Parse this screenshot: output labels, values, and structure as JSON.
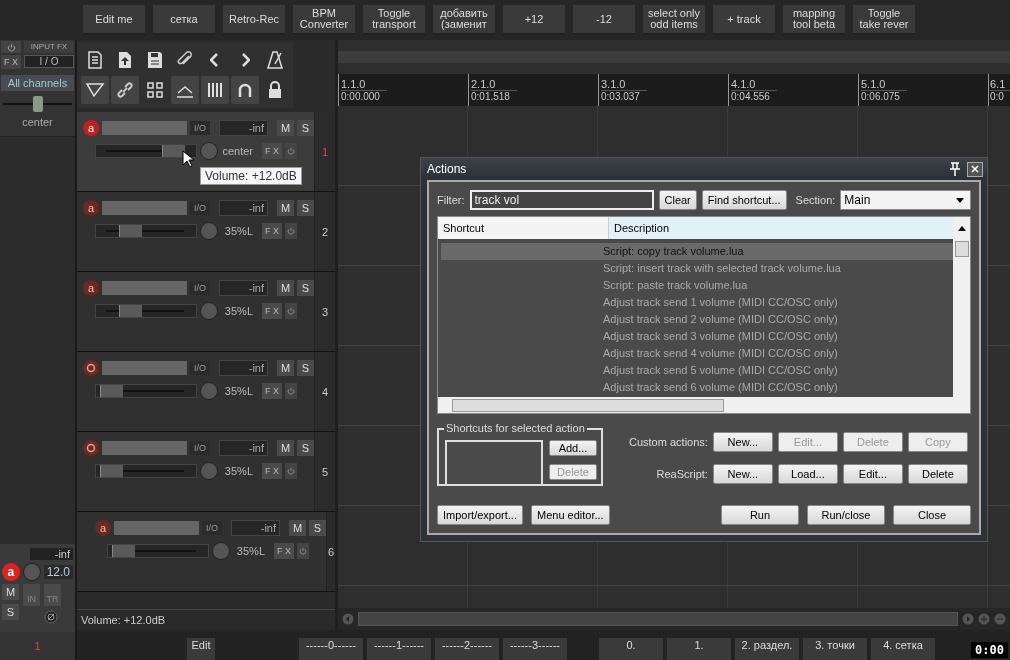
{
  "toolbar": {
    "buttons": [
      {
        "lines": [
          "Edit me"
        ]
      },
      {
        "lines": [
          "сетка"
        ]
      },
      {
        "lines": [
          "Retro-Rec"
        ]
      },
      {
        "lines": [
          "BPM",
          "Converter"
        ]
      },
      {
        "lines": [
          "Toggle",
          "transport"
        ]
      },
      {
        "lines": [
          "добавить",
          "(заменит"
        ]
      },
      {
        "lines": [
          "+12"
        ]
      },
      {
        "lines": [
          "-12"
        ]
      },
      {
        "lines": [
          "select only",
          "odd items"
        ]
      },
      {
        "lines": [
          "+ track"
        ]
      },
      {
        "lines": [
          "mapping",
          "tool beta"
        ]
      },
      {
        "lines": [
          "Toggle",
          "take rever"
        ]
      }
    ]
  },
  "master": {
    "input_fx": "INPUT FX",
    "fx": "F X",
    "io": "I / O",
    "channels": "All channels",
    "pan": {
      "level": 0.5,
      "reading": "center"
    },
    "meter": "-inf",
    "record_label": "a",
    "volume": "12.0",
    "mute": "M",
    "solo": "S",
    "in_label": "IN",
    "tr_label": "TR",
    "number": "1"
  },
  "tools": [
    {
      "kind": "document",
      "on": false
    },
    {
      "kind": "upload",
      "on": false
    },
    {
      "kind": "save",
      "on": false
    },
    {
      "kind": "paperclip",
      "on": false
    },
    {
      "kind": "left",
      "on": false
    },
    {
      "kind": "right",
      "on": false
    },
    {
      "kind": "metronome",
      "on": false
    },
    {
      "kind": "funnel",
      "on": true
    },
    {
      "kind": "link",
      "on": true
    },
    {
      "kind": "grid",
      "on": false
    },
    {
      "kind": "ramp",
      "on": true
    },
    {
      "kind": "bars",
      "on": true
    },
    {
      "kind": "magnet",
      "on": true
    },
    {
      "kind": "lock",
      "on": false
    }
  ],
  "tracks": [
    {
      "number": "1",
      "selected": true,
      "record_label": "a",
      "io": "I/O",
      "meter": "-inf",
      "mute": "M",
      "solo": "S",
      "fx": "F X",
      "pan": "center",
      "level": 0.85,
      "indented": false
    },
    {
      "number": "2",
      "selected": false,
      "record_label": "a",
      "io": "I/O",
      "meter": "-inf",
      "mute": "M",
      "solo": "S",
      "fx": "F X",
      "pan": "35%L",
      "level": 0.3,
      "indented": false
    },
    {
      "number": "3",
      "selected": false,
      "record_label": "a",
      "io": "I/O",
      "meter": "-inf",
      "mute": "M",
      "solo": "S",
      "fx": "F X",
      "pan": "35%L",
      "level": 0.3,
      "indented": false
    },
    {
      "number": "4",
      "selected": false,
      "io": "I/O",
      "meter": "-inf",
      "mute": "M",
      "solo": "S",
      "fx": "F X",
      "pan": "35%L",
      "level": 0.05,
      "indented": false
    },
    {
      "number": "5",
      "selected": false,
      "io": "I/O",
      "meter": "-inf",
      "mute": "M",
      "solo": "S",
      "fx": "F X",
      "pan": "35%L",
      "level": 0.05,
      "indented": false
    },
    {
      "number": "6",
      "selected": false,
      "record_label": "a",
      "io": "I/O",
      "meter": "-inf",
      "mute": "M",
      "solo": "S",
      "fx": "F X",
      "pan": "35%L",
      "level": 0.05,
      "indented": true
    }
  ],
  "tooltip": "Volume: +12.0dB",
  "status": "Volume: +12.0dB",
  "ruler": [
    {
      "bar": "1.1.0",
      "time": "0:00.000"
    },
    {
      "bar": "2.1.0",
      "time": "0:01.518"
    },
    {
      "bar": "3.1.0",
      "time": "0:03.037"
    },
    {
      "bar": "4.1.0",
      "time": "0:04.556"
    },
    {
      "bar": "5.1.0",
      "time": "0:06.075"
    },
    {
      "bar": "6.1",
      "time": "0:0"
    }
  ],
  "actions": {
    "title": "Actions",
    "filter_label": "Filter:",
    "filter": "track vol",
    "clear": "Clear",
    "find": "Find shortcut...",
    "section_label": "Section:",
    "section": "Main",
    "columns": [
      "Shortcut",
      "Description"
    ],
    "rows": [
      {
        "description": "Script: copy track volume.lua",
        "selected": true
      },
      {
        "description": "Script: insert track with selected track volume.lua",
        "selected": false
      },
      {
        "description": "Script: paste track volume.lua",
        "selected": false
      },
      {
        "description": "Adjust track send 1 volume (MIDI CC/OSC only)",
        "selected": false
      },
      {
        "description": "Adjust track send 2 volume (MIDI CC/OSC only)",
        "selected": false
      },
      {
        "description": "Adjust track send 3 volume (MIDI CC/OSC only)",
        "selected": false
      },
      {
        "description": "Adjust track send 4 volume (MIDI CC/OSC only)",
        "selected": false
      },
      {
        "description": "Adjust track send 5 volume (MIDI CC/OSC only)",
        "selected": false
      },
      {
        "description": "Adjust track send 6 volume (MIDI CC/OSC only)",
        "selected": false
      }
    ],
    "shortcuts_group": "Shortcuts for selected action",
    "add": {
      "label": "Add...",
      "disabled": false
    },
    "remove": {
      "label": "Delete",
      "disabled": true
    },
    "custom_label": "Custom actions:",
    "custom": [
      {
        "label": "New...",
        "disabled": false
      },
      {
        "label": "Edit...",
        "disabled": true
      },
      {
        "label": "Delete",
        "disabled": true
      },
      {
        "label": "Copy",
        "disabled": true
      }
    ],
    "reascript_label": "ReaScript:",
    "reascript": [
      {
        "label": "New...",
        "disabled": false
      },
      {
        "label": "Load...",
        "disabled": false
      },
      {
        "label": "Edit...",
        "disabled": false
      },
      {
        "label": "Delete",
        "disabled": false
      }
    ],
    "import": "Import/export...",
    "menu_editor": "Menu editor...",
    "run": "Run",
    "run_close": "Run/close",
    "close": "Close"
  },
  "bottom_buttons": [
    {
      "lines": [
        "Edit"
      ]
    },
    {
      "lines": [
        "------0------"
      ]
    },
    {
      "lines": [
        "------1------"
      ]
    },
    {
      "lines": [
        "------2------"
      ]
    },
    {
      "lines": [
        "------3------"
      ]
    },
    {
      "lines": [
        "0."
      ]
    },
    {
      "lines": [
        "1."
      ]
    },
    {
      "lines": [
        "2. раздел."
      ]
    },
    {
      "lines": [
        "3. точки"
      ]
    },
    {
      "lines": [
        "4. сетка"
      ]
    }
  ],
  "clock": "0:00"
}
